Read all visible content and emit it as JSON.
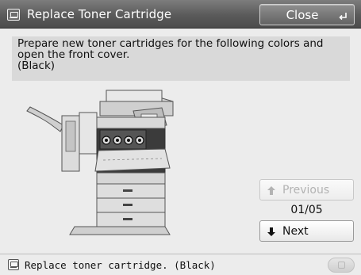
{
  "window": {
    "title": "Replace Toner Cartridge",
    "title_icon": "cartridge-icon",
    "close_label": "Close",
    "close_icon": "enter-return-icon"
  },
  "message": {
    "text": "Prepare new toner cartridges for the following colors and\nopen the front cover.\n(Black)"
  },
  "illustration": {
    "subject": "printer-with-front-cover-open-icon"
  },
  "navigation": {
    "previous_label": "Previous",
    "previous_enabled": false,
    "page": "01/05",
    "next_label": "Next",
    "next_enabled": true,
    "up_arrow_icon": "up-arrow-icon",
    "down_arrow_icon": "down-arrow-icon"
  },
  "status": {
    "icon": "cartridge-icon",
    "text": "Replace toner cartridge. (Black)",
    "round_button_icon": "status-monitor-icon"
  },
  "colors": {
    "title_bar": "#5a5a5a",
    "message_background": "#d9d9d9",
    "screen_background": "#ececec",
    "disabled_text": "#b3b3b3"
  }
}
